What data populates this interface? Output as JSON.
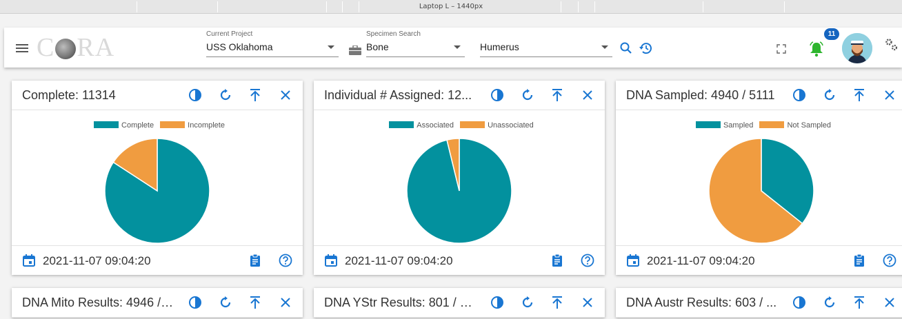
{
  "ruler": {
    "label": "Laptop L – 1440px"
  },
  "app": {
    "logo_text_left": "C",
    "logo_text_right": "RA"
  },
  "project": {
    "label": "Current Project",
    "value": "USS Oklahoma"
  },
  "specimen": {
    "label": "Specimen Search",
    "value": "Bone",
    "element_value": "Humerus"
  },
  "notifications": {
    "count": "11"
  },
  "colors": {
    "teal": "#03919e",
    "orange": "#f09c40",
    "accent": "#1976d2",
    "bell": "#2db52d"
  },
  "cards": [
    {
      "title": "Complete: 11314",
      "legend": [
        "Complete",
        "Incomplete"
      ],
      "slices": [
        {
          "label": "Complete",
          "value": 0.842
        },
        {
          "label": "Incomplete",
          "value": 0.158
        }
      ],
      "date": "2021-11-07 09:04:20"
    },
    {
      "title": "Individual # Assigned: 12...",
      "legend": [
        "Associated",
        "Unassociated"
      ],
      "slices": [
        {
          "label": "Associated",
          "value": 0.962
        },
        {
          "label": "Unassociated",
          "value": 0.038
        }
      ],
      "date": "2021-11-07 09:04:20"
    },
    {
      "title": "DNA Sampled: 4940 / 5111",
      "legend": [
        "Sampled",
        "Not Sampled"
      ],
      "slices": [
        {
          "label": "Sampled",
          "value": 0.357
        },
        {
          "label": "Not Sampled",
          "value": 0.643
        }
      ],
      "date": "2021-11-07 09:04:20"
    },
    {
      "title": "DNA Mito Results: 4946 / ..."
    },
    {
      "title": "DNA YStr Results: 801 / 5..."
    },
    {
      "title": "DNA Austr Results: 603 / ..."
    }
  ]
}
